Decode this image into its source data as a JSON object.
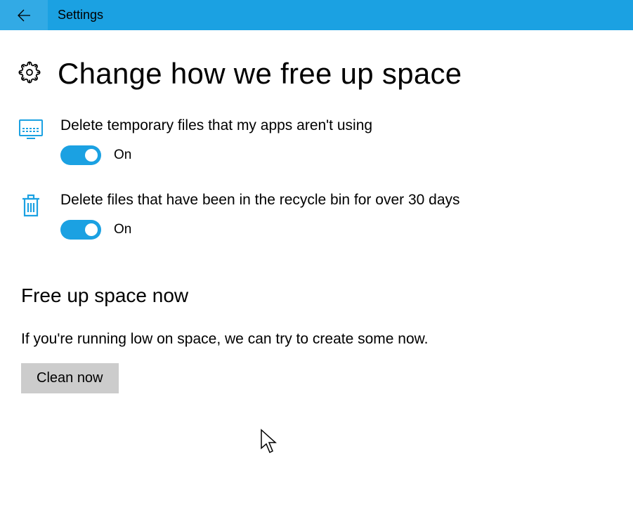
{
  "titleBar": {
    "appName": "Settings"
  },
  "header": {
    "title": "Change how we free up space"
  },
  "settings": [
    {
      "label": "Delete temporary files that my apps aren't using",
      "state": "On"
    },
    {
      "label": "Delete files that have been in the recycle bin for over 30 days",
      "state": "On"
    }
  ],
  "freeUpNow": {
    "heading": "Free up space now",
    "description": "If you're running low on space, we can try to create some now.",
    "buttonLabel": "Clean now"
  },
  "colors": {
    "accent": "#1ba1e2"
  }
}
